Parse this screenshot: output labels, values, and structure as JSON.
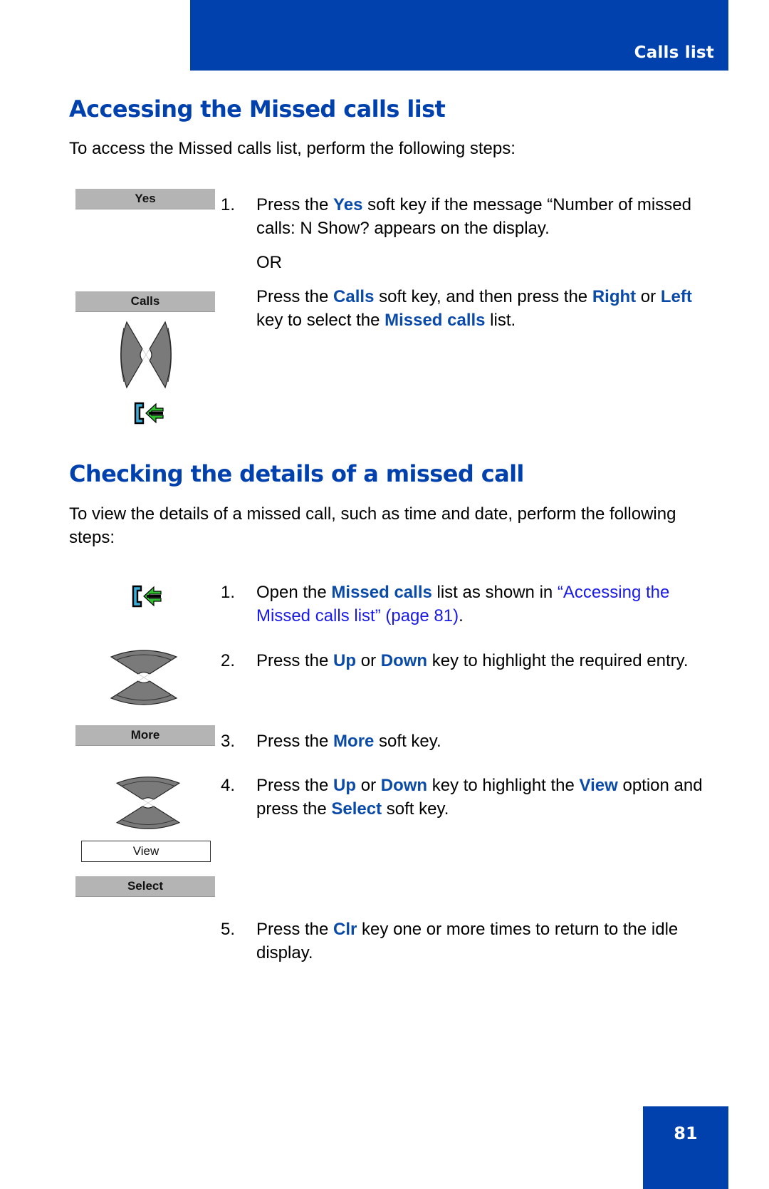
{
  "header": {
    "section_title": "Calls list"
  },
  "section1": {
    "heading": "Accessing the Missed calls list",
    "intro": "To access the Missed calls list, perform the following steps:",
    "softkeys": {
      "yes": "Yes",
      "calls": "Calls"
    },
    "step1": {
      "num": "1.",
      "t1": "Press the ",
      "k1": "Yes",
      "t2": " soft key if the message “Number of missed calls: N Show?  appears on the display."
    },
    "or": "OR",
    "alt": {
      "t1": "Press the ",
      "k1": "Calls",
      "t2": " soft key, and then press the ",
      "k2": "Right",
      "t3": " or ",
      "k3": "Left",
      "t4": " key to select the ",
      "k4": "Missed calls",
      "t5": " list."
    },
    "icons": [
      "left-right-nav-key-icon",
      "missed-calls-icon"
    ]
  },
  "section2": {
    "heading": "Checking the details of a missed call",
    "intro": "To view the details of a missed call, such as time and date, perform the following steps:",
    "softkeys": {
      "more": "More",
      "select": "Select"
    },
    "display_option": "View",
    "steps": [
      {
        "num": "1.",
        "t1": "Open the ",
        "k1": "Missed calls",
        "t2": " list as shown in ",
        "link": "“Accessing the Missed calls list” (page 81)",
        "t3": "."
      },
      {
        "num": "2.",
        "t1": "Press the ",
        "k1": "Up",
        "t2": " or ",
        "k2": "Down",
        "t3": " key to highlight the required entry."
      },
      {
        "num": "3.",
        "t1": "Press the ",
        "k1": "More",
        "t2": " soft key."
      },
      {
        "num": "4.",
        "t1": "Press the ",
        "k1": "Up",
        "t2": " or ",
        "k2": "Down",
        "t3": " key to highlight the ",
        "k3": "View",
        "t4": " option and press the ",
        "k4": "Select",
        "t5": " soft key."
      },
      {
        "num": "5.",
        "t1": "Press the ",
        "k1": "Clr",
        "t2": " key one or more times to return to the idle display."
      }
    ],
    "icons": [
      "missed-calls-icon",
      "up-down-nav-key-icon"
    ]
  },
  "footer": {
    "page_number": "81"
  },
  "colors": {
    "brand_blue": "#0041ad",
    "keyword_blue": "#0a4aa8",
    "link_blue": "#1a1ae6",
    "softkey_gray": "#b4b4b4"
  }
}
